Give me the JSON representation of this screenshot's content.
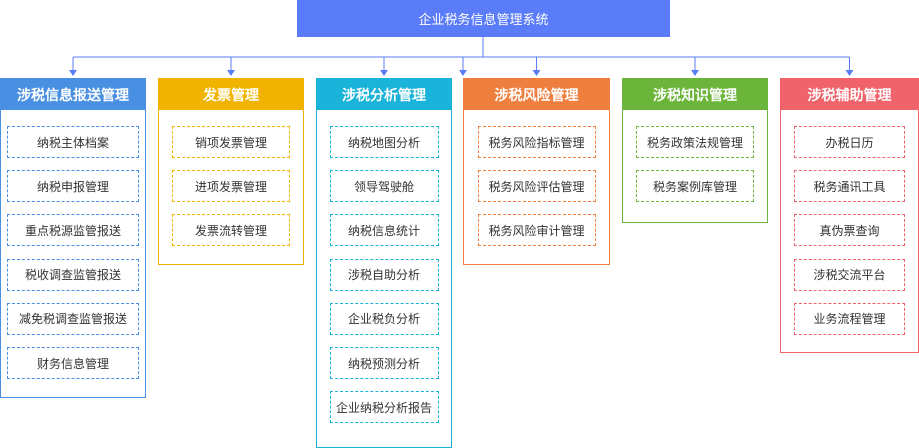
{
  "root": {
    "title": "企业税务信息管理系统",
    "color": "#5b7cf8"
  },
  "line_color": "#5b7cf8",
  "columns": [
    {
      "title": "涉税信息报送管理",
      "color": "#4a90e2",
      "items": [
        "纳税主体档案",
        "纳税申报管理",
        "重点税源监管报送",
        "税收调查监管报送",
        "减免税调查监管报送",
        "财务信息管理"
      ]
    },
    {
      "title": "发票管理",
      "color": "#f0b400",
      "items": [
        "销项发票管理",
        "进项发票管理",
        "发票流转管理"
      ]
    },
    {
      "title": "涉税分析管理",
      "color": "#1ab3d9",
      "items": [
        "纳税地图分析",
        "领导驾驶舱",
        "纳税信息统计",
        "涉税自助分析",
        "企业税负分析",
        "纳税预测分析",
        "企业纳税分析报告"
      ]
    },
    {
      "title": "涉税风险管理",
      "color": "#ef7f3e",
      "items": [
        "税务风险指标管理",
        "税务风险评估管理",
        "税务风险审计管理"
      ]
    },
    {
      "title": "涉税知识管理",
      "color": "#6bb53a",
      "items": [
        "税务政策法规管理",
        "税务案例库管理"
      ]
    },
    {
      "title": "涉税辅助管理",
      "color": "#f0636b",
      "items": [
        "办税日历",
        "税务通讯工具",
        "真伪票查询",
        "涉税交流平台",
        "业务流程管理"
      ]
    }
  ]
}
